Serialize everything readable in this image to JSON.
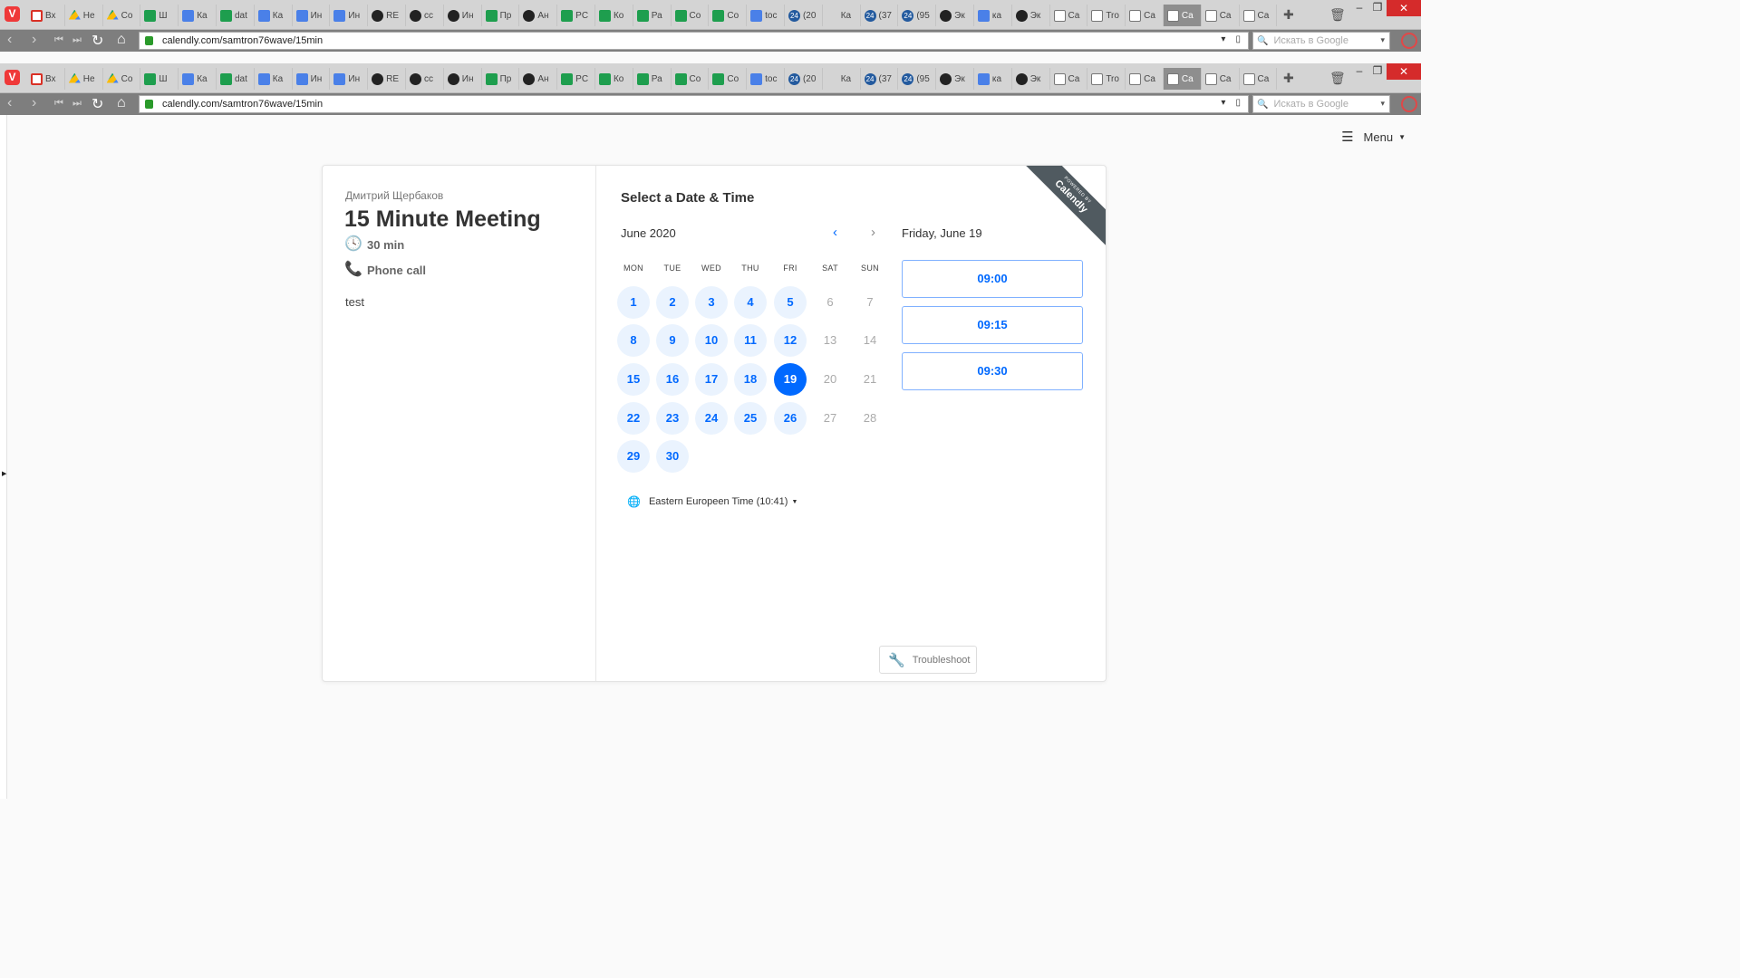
{
  "browser": {
    "tabs": [
      {
        "icon": "gmail-icon",
        "label": "Вх"
      },
      {
        "icon": "drive-icon",
        "label": "Не"
      },
      {
        "icon": "drive-icon",
        "label": "Co"
      },
      {
        "icon": "sheets-icon",
        "label": "Ш"
      },
      {
        "icon": "docs-icon",
        "label": "Ка"
      },
      {
        "icon": "sheets-icon",
        "label": "dat"
      },
      {
        "icon": "docs-icon",
        "label": "Ка"
      },
      {
        "icon": "docs-icon",
        "label": "Ин"
      },
      {
        "icon": "docs-icon",
        "label": "Ин"
      },
      {
        "icon": "github-icon",
        "label": "RE"
      },
      {
        "icon": "github-icon",
        "label": "cc"
      },
      {
        "icon": "github-icon",
        "label": "Ин"
      },
      {
        "icon": "sheets-icon",
        "label": "Пр"
      },
      {
        "icon": "github-icon",
        "label": "Ан"
      },
      {
        "icon": "sheets-icon",
        "label": "PC"
      },
      {
        "icon": "sheets-icon",
        "label": "Ко"
      },
      {
        "icon": "sheets-icon",
        "label": "Ра"
      },
      {
        "icon": "sheets-icon",
        "label": "Co"
      },
      {
        "icon": "sheets-icon",
        "label": "Co"
      },
      {
        "icon": "docs-icon",
        "label": "toc"
      },
      {
        "icon": "news24-icon",
        "label": "(20"
      },
      {
        "icon": "blank-icon",
        "label": "Ка"
      },
      {
        "icon": "news24-icon",
        "label": "(37"
      },
      {
        "icon": "news24-icon",
        "label": "(95"
      },
      {
        "icon": "github-icon",
        "label": "Эк"
      },
      {
        "icon": "docs-icon",
        "label": "ка"
      },
      {
        "icon": "github-icon",
        "label": "Эк"
      },
      {
        "icon": "calendly-icon",
        "label": "Ca"
      },
      {
        "icon": "calendly-icon",
        "label": "Tro"
      },
      {
        "icon": "calendly-icon",
        "label": "Ca"
      },
      {
        "icon": "calendly-icon",
        "label": "Ca",
        "active": true
      },
      {
        "icon": "calendly-icon",
        "label": "Ca"
      },
      {
        "icon": "calendly-icon",
        "label": "Ca"
      }
    ],
    "url": "calendly.com/samtron76wave/15min",
    "search_placeholder": "Искать в Google"
  },
  "page": {
    "menu_label": "Menu",
    "host_name": "Дмитрий Щербаков",
    "event_title": "15 Minute Meeting",
    "duration": "30 min",
    "location": "Phone call",
    "description": "test",
    "select_title": "Select a Date & Time",
    "month_label": "June 2020",
    "weekdays": [
      "MON",
      "TUE",
      "WED",
      "THU",
      "FRI",
      "SAT",
      "SUN"
    ],
    "days": [
      {
        "n": "1",
        "s": "avail"
      },
      {
        "n": "2",
        "s": "avail"
      },
      {
        "n": "3",
        "s": "avail"
      },
      {
        "n": "4",
        "s": "avail"
      },
      {
        "n": "5",
        "s": "avail"
      },
      {
        "n": "6",
        "s": "off"
      },
      {
        "n": "7",
        "s": "off"
      },
      {
        "n": "8",
        "s": "avail"
      },
      {
        "n": "9",
        "s": "avail"
      },
      {
        "n": "10",
        "s": "avail"
      },
      {
        "n": "11",
        "s": "avail"
      },
      {
        "n": "12",
        "s": "avail"
      },
      {
        "n": "13",
        "s": "off"
      },
      {
        "n": "14",
        "s": "off"
      },
      {
        "n": "15",
        "s": "avail"
      },
      {
        "n": "16",
        "s": "avail"
      },
      {
        "n": "17",
        "s": "avail"
      },
      {
        "n": "18",
        "s": "avail"
      },
      {
        "n": "19",
        "s": "sel"
      },
      {
        "n": "20",
        "s": "off"
      },
      {
        "n": "21",
        "s": "off"
      },
      {
        "n": "22",
        "s": "avail"
      },
      {
        "n": "23",
        "s": "avail"
      },
      {
        "n": "24",
        "s": "avail"
      },
      {
        "n": "25",
        "s": "avail"
      },
      {
        "n": "26",
        "s": "avail"
      },
      {
        "n": "27",
        "s": "off"
      },
      {
        "n": "28",
        "s": "off"
      },
      {
        "n": "29",
        "s": "avail"
      },
      {
        "n": "30",
        "s": "avail"
      }
    ],
    "timezone": "Eastern Europeen Time (10:41)",
    "selected_date": "Friday, June 19",
    "time_slots": [
      "09:00",
      "09:15",
      "09:30"
    ],
    "ribbon_small": "POWERED BY",
    "ribbon_brand": "Calendly",
    "troubleshoot_label": "Troubleshoot"
  },
  "colors": {
    "accent": "#0069ff",
    "available_day_bg": "#eaf3fe",
    "ribbon": "#505a60"
  }
}
